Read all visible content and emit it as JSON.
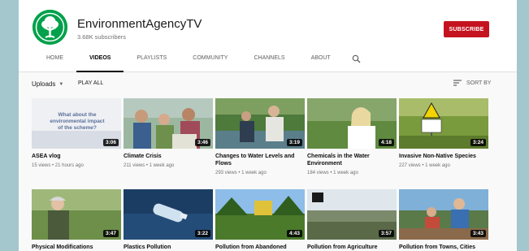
{
  "channel": {
    "name": "EnvironmentAgencyTV",
    "subscribers": "3.68K subscribers",
    "subscribe_label": "SUBSCRIBE",
    "logo_icon": "environment-agency-tree-logo",
    "brand_color": "#00a14b"
  },
  "tabs": [
    {
      "label": "HOME"
    },
    {
      "label": "VIDEOS"
    },
    {
      "label": "PLAYLISTS"
    },
    {
      "label": "COMMUNITY"
    },
    {
      "label": "CHANNELS"
    },
    {
      "label": "ABOUT"
    }
  ],
  "active_tab": "VIDEOS",
  "search_icon": "search-icon",
  "subbar": {
    "uploads_label": "Uploads",
    "play_all_label": "PLAY ALL",
    "sort_label": "SORT BY"
  },
  "videos": [
    {
      "title": "ASEA vlog",
      "meta": "15 views • 21 hours ago",
      "duration": "3:06",
      "thumb_text": "What about the environmental impact of the scheme?"
    },
    {
      "title": "Climate Crisis",
      "meta": "211 views • 1 week ago",
      "duration": "3:46"
    },
    {
      "title": "Changes to Water Levels and Flows",
      "meta": "293 views • 1 week ago",
      "duration": "3:19"
    },
    {
      "title": "Chemicals in the Water Environment",
      "meta": "184 views • 1 week ago",
      "duration": "4:18"
    },
    {
      "title": "Invasive Non-Native Species",
      "meta": "227 views • 1 week ago",
      "duration": "3:24"
    },
    {
      "title": "Physical Modifications",
      "meta": "",
      "duration": "3:47"
    },
    {
      "title": "Plastics Pollution",
      "meta": "",
      "duration": "3:22"
    },
    {
      "title": "Pollution from Abandoned",
      "meta": "",
      "duration": "4:43"
    },
    {
      "title": "Pollution from Agriculture",
      "meta": "",
      "duration": "3:57"
    },
    {
      "title": "Pollution from Towns, Cities",
      "meta": "",
      "duration": "3:43"
    }
  ]
}
